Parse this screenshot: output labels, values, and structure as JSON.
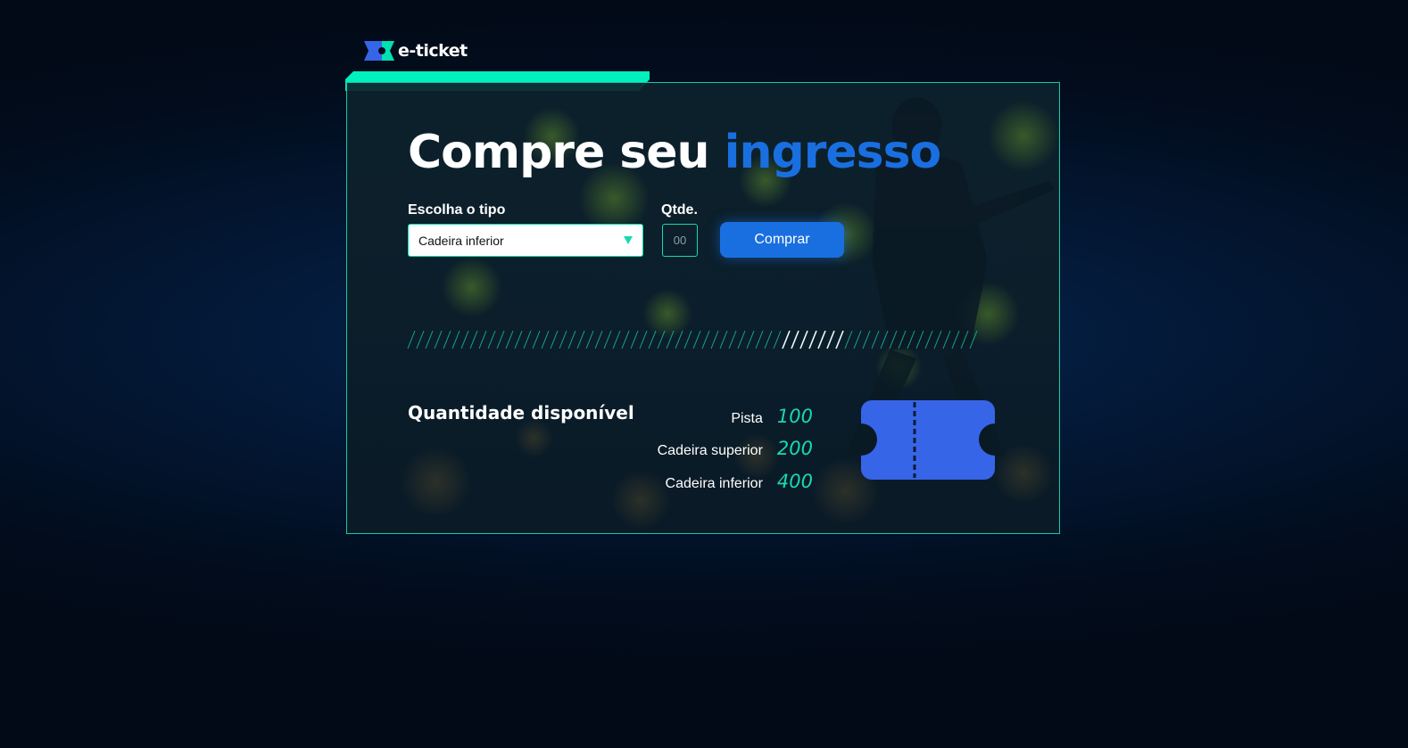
{
  "brand": {
    "name": "e-ticket"
  },
  "hero": {
    "title_main": "Compre seu",
    "title_accent": "ingresso"
  },
  "form": {
    "type_label": "Escolha o tipo",
    "type_selected": "Cadeira inferior",
    "qty_label": "Qtde.",
    "qty_placeholder": "00",
    "buy_label": "Comprar"
  },
  "availability": {
    "title": "Quantidade disponível",
    "items": [
      {
        "name": "Pista",
        "value": "100"
      },
      {
        "name": "Cadeira superior",
        "value": "200"
      },
      {
        "name": "Cadeira inferior",
        "value": "400"
      }
    ]
  },
  "colors": {
    "accent_teal": "#00f0be",
    "accent_blue": "#1a6fe0",
    "ticket_blue": "#3765e8"
  }
}
